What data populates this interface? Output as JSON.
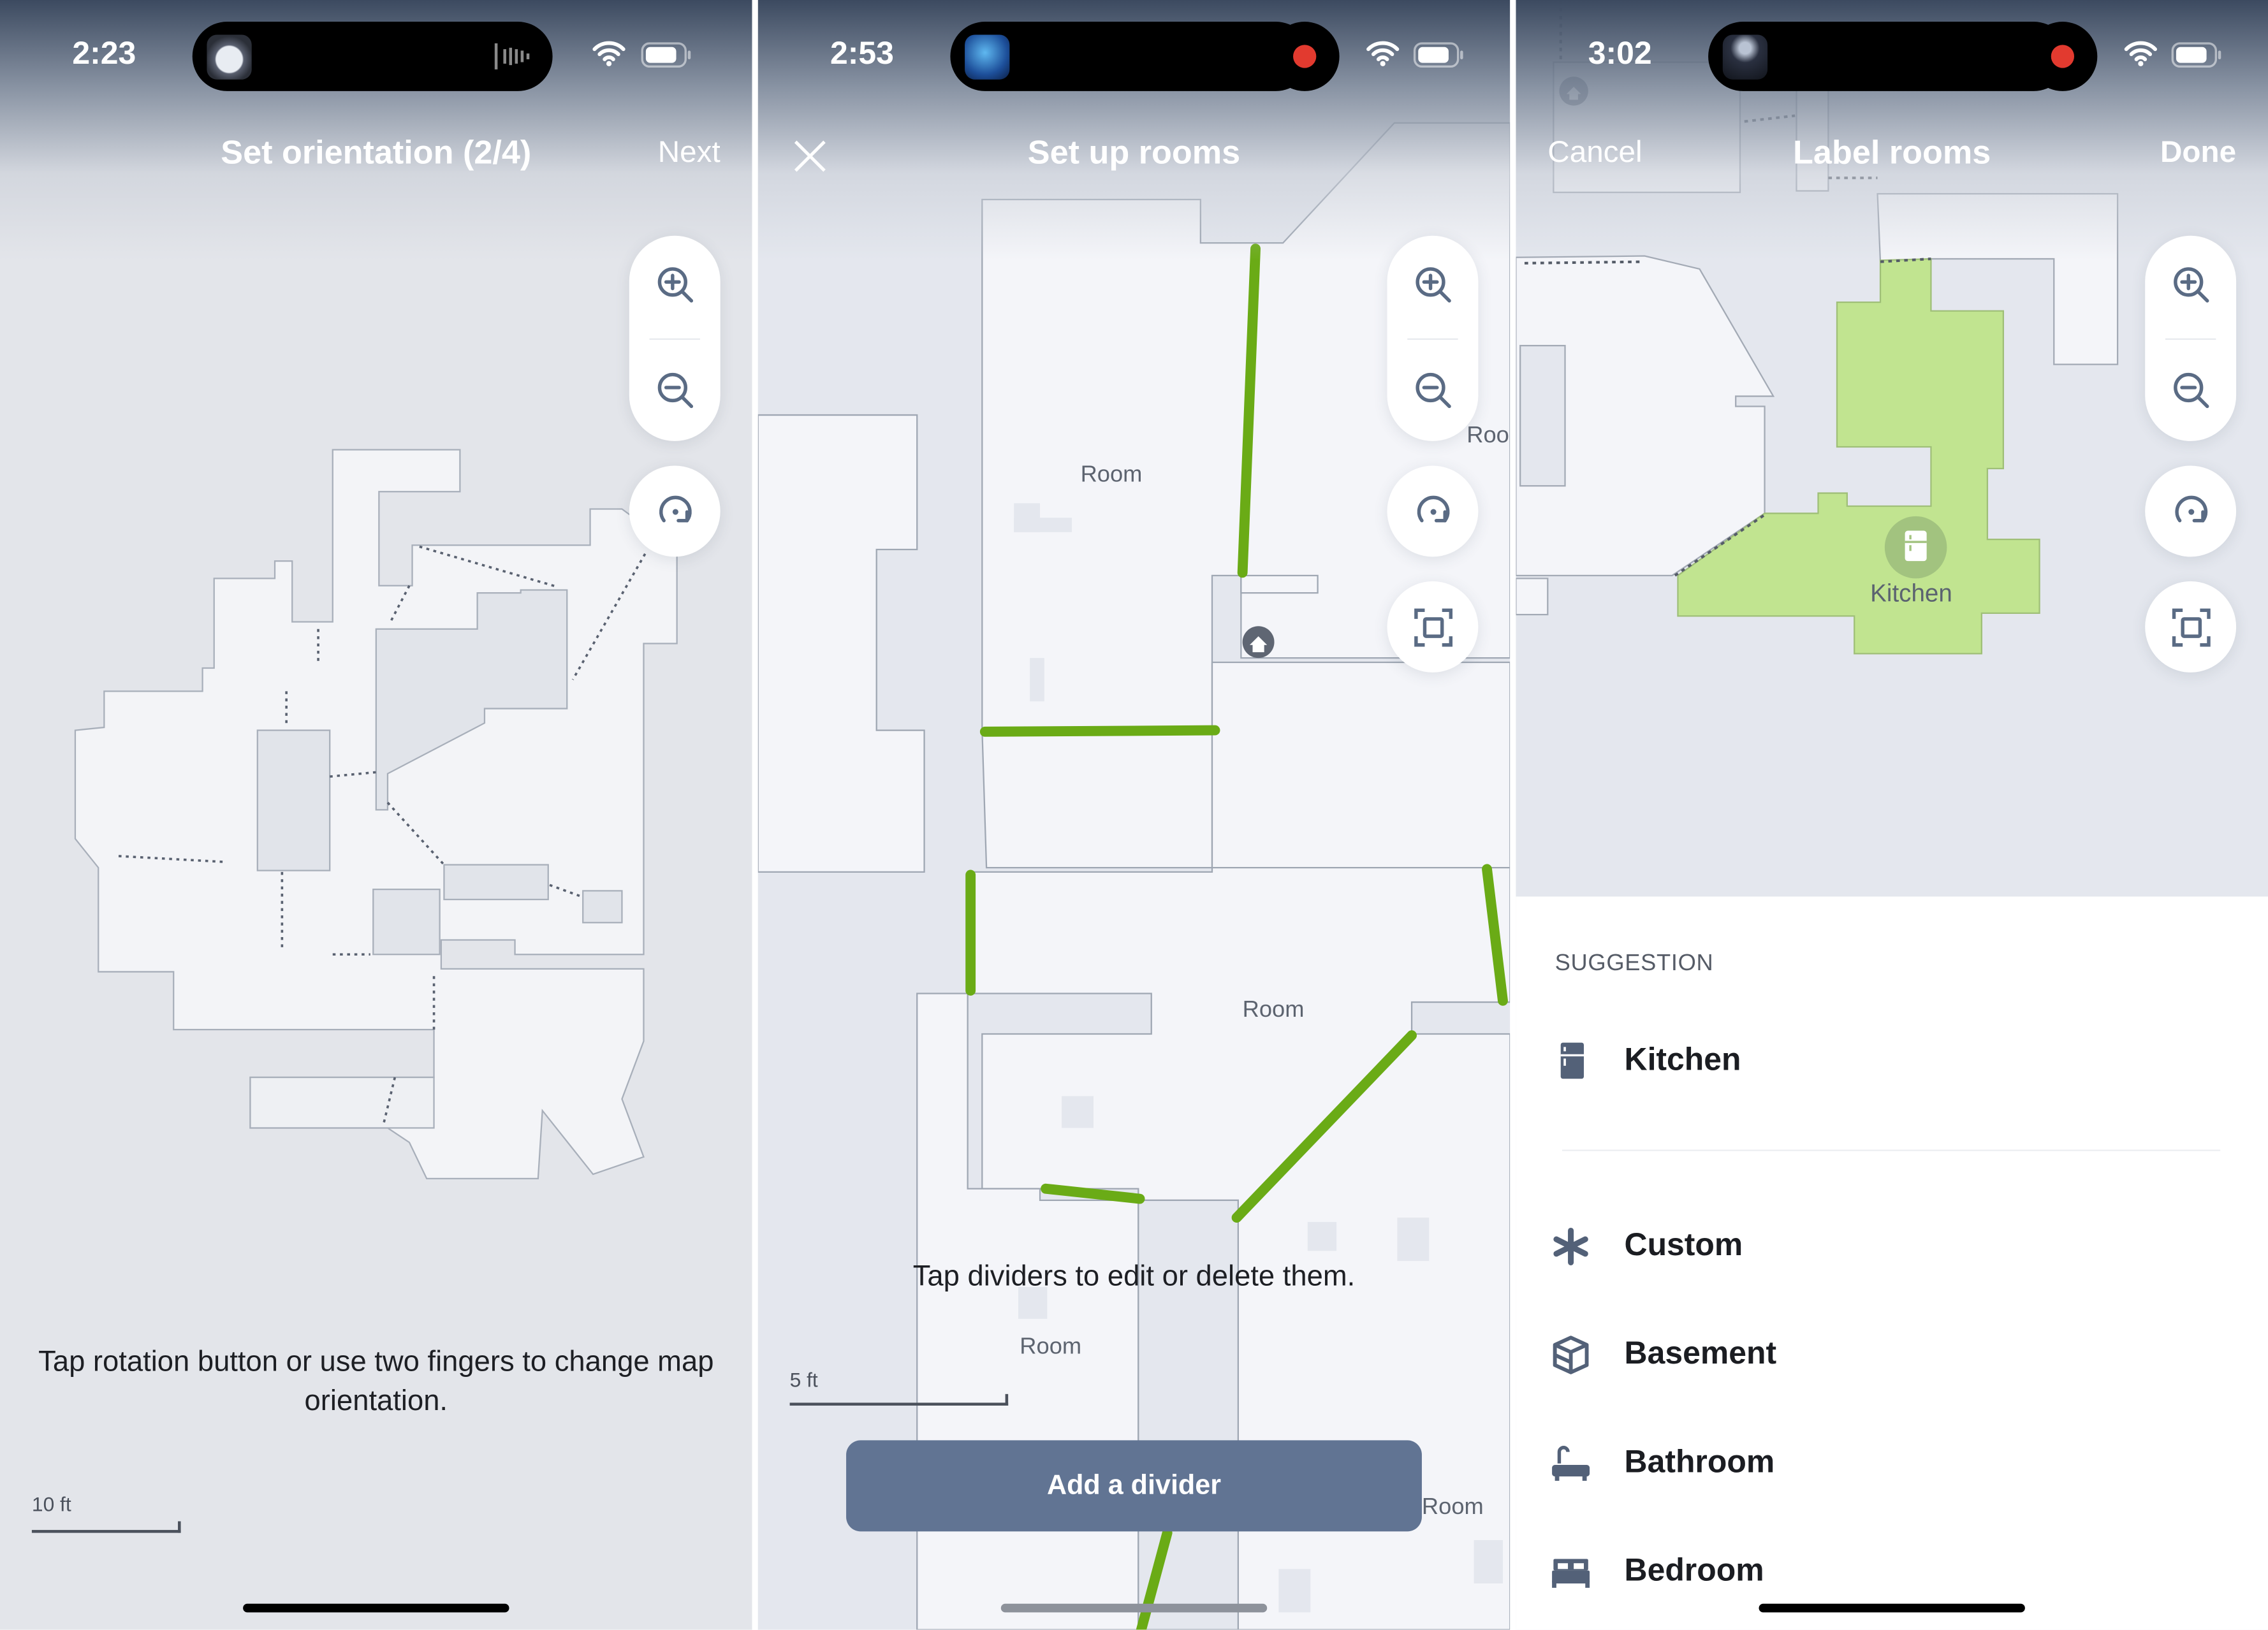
{
  "colors": {
    "accent_green": "#6aab16",
    "room_green": "#c1e490",
    "button": "#617493",
    "record": "#e23a2f"
  },
  "icons": {
    "zoom_in": "magnifier-plus-icon",
    "zoom_out": "magnifier-minus-icon",
    "rotate": "rotate-icon",
    "fit": "fit-frame-icon",
    "home": "home-icon",
    "close": "close-x-icon"
  },
  "screens": [
    {
      "status": {
        "time": "2:23"
      },
      "nav": {
        "title": "Set orientation (2/4)",
        "right": "Next"
      },
      "hint": "Tap rotation button or use two fingers to change map orientation.",
      "scale": "10 ft"
    },
    {
      "status": {
        "time": "2:53"
      },
      "nav": {
        "title": "Set up rooms"
      },
      "room_labels": [
        "Room",
        "Room",
        "Room",
        "Room",
        "Roo"
      ],
      "hint": "Tap dividers to edit or delete them.",
      "scale": "5 ft",
      "button": "Add a divider"
    },
    {
      "status": {
        "time": "3:02"
      },
      "nav": {
        "left": "Cancel",
        "title": "Label rooms",
        "right": "Done"
      },
      "room_label": "Kitchen",
      "sheet": {
        "section": "SUGGESTION",
        "suggestion": {
          "label": "Kitchen",
          "icon": "fridge-icon"
        },
        "items": [
          {
            "label": "Custom",
            "icon": "asterisk-icon"
          },
          {
            "label": "Basement",
            "icon": "box-icon"
          },
          {
            "label": "Bathroom",
            "icon": "bathtub-icon"
          },
          {
            "label": "Bedroom",
            "icon": "bed-icon"
          }
        ]
      }
    }
  ]
}
